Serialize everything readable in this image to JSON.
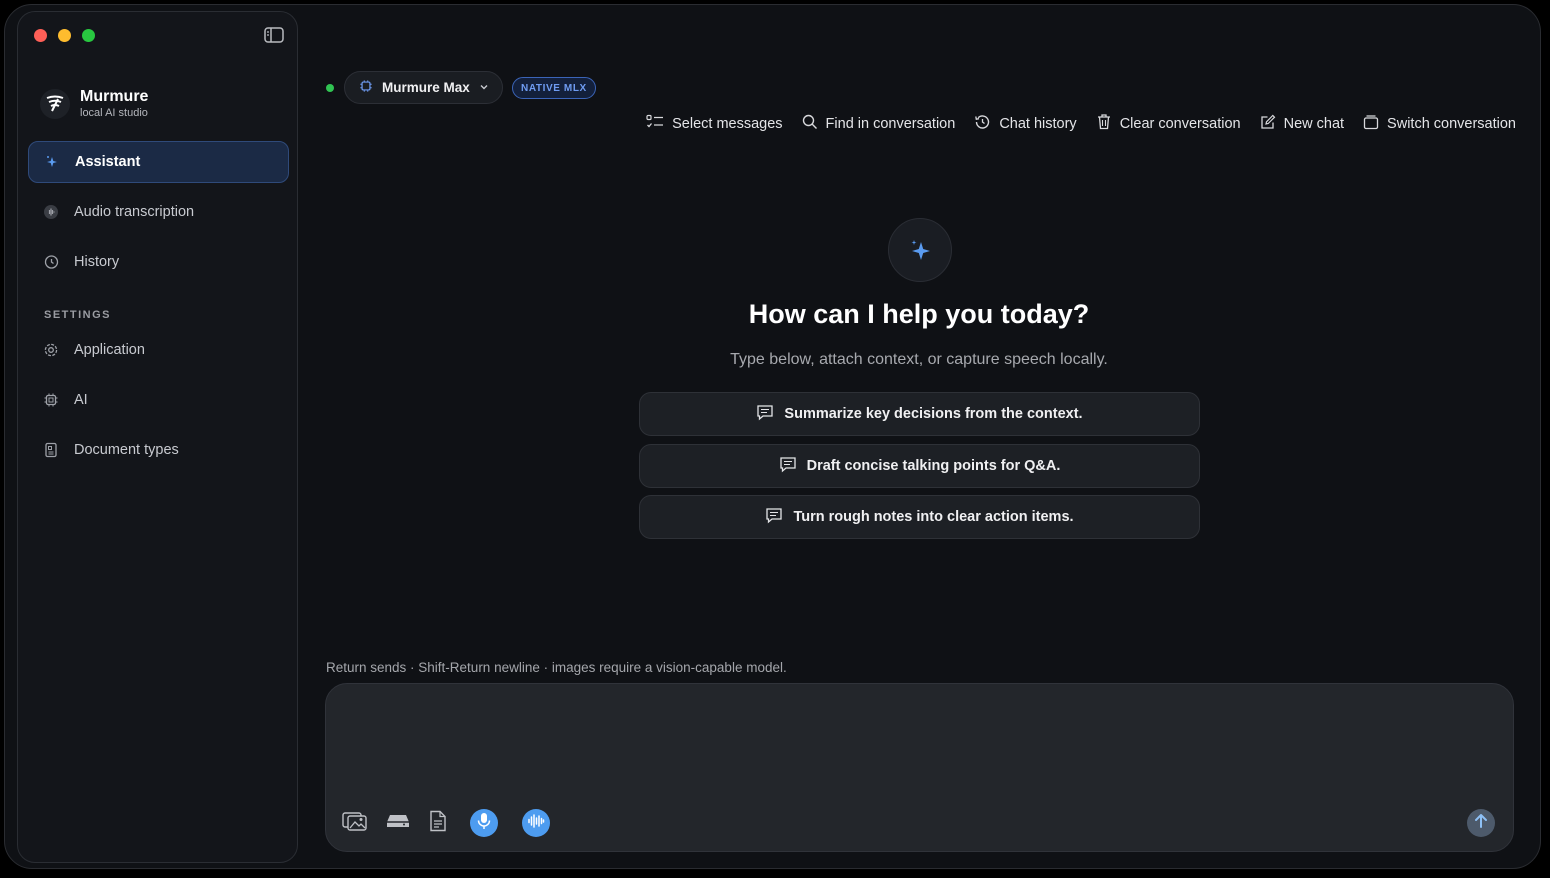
{
  "sidebar": {
    "brand_title": "Murmure",
    "brand_subtitle": "local AI studio",
    "items": [
      {
        "label": "Assistant",
        "icon": "sparkle-icon",
        "active": true
      },
      {
        "label": "Audio transcription",
        "icon": "waveform-icon",
        "active": false
      },
      {
        "label": "History",
        "icon": "clock-history-icon",
        "active": false
      }
    ],
    "settings_label": "SETTINGS",
    "settings_items": [
      {
        "label": "Application",
        "icon": "gear-icon"
      },
      {
        "label": "AI",
        "icon": "chip-icon"
      },
      {
        "label": "Document types",
        "icon": "document-icon"
      }
    ]
  },
  "header": {
    "model_name": "Murmure Max",
    "badge": "NATIVE MLX",
    "status_color": "#30c452"
  },
  "toolbar": {
    "select_messages": "Select messages",
    "find_in_conversation": "Find in conversation",
    "chat_history": "Chat history",
    "clear_conversation": "Clear conversation",
    "new_chat": "New chat",
    "switch_conversation": "Switch conversation"
  },
  "main": {
    "title": "How can I help you today?",
    "subtitle": "Type below, attach context, or capture speech locally.",
    "suggestions": [
      "Summarize key decisions from the context.",
      "Draft concise talking points for Q&A.",
      "Turn rough notes into clear action items."
    ]
  },
  "composer": {
    "hint": "Return sends · Shift-Return newline · images require a vision-capable model.",
    "value": "",
    "placeholder": ""
  },
  "colors": {
    "accent": "#4d9cf0",
    "active_nav_bg": "#1b2a45",
    "badge_text": "#6f9cf2"
  }
}
